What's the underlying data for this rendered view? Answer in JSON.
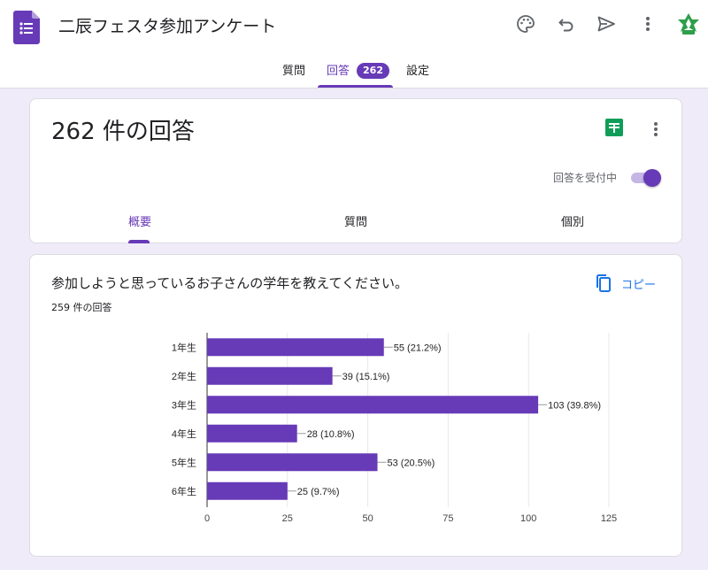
{
  "header": {
    "title": "二辰フェスタ参加アンケート",
    "icons": [
      "forms-logo",
      "palette-icon",
      "undo-icon",
      "send-icon",
      "more-vert-icon",
      "avatar-icon"
    ]
  },
  "tabs": [
    {
      "label": "質問"
    },
    {
      "label": "回答",
      "badge": "262"
    },
    {
      "label": "設定"
    }
  ],
  "summary": {
    "title": "262 件の回答",
    "accepting_label": "回答を受付中",
    "accepting": true,
    "subtabs": [
      {
        "label": "概要"
      },
      {
        "label": "質問"
      },
      {
        "label": "個別"
      }
    ]
  },
  "question": {
    "title": "参加しようと思っているお子さんの学年を教えてください。",
    "response_count": "259 件の回答",
    "copy_label": "コピー"
  },
  "colors": {
    "accent": "#673ab7",
    "bar": "#673ab7",
    "link": "#1a73e8",
    "sheets": "#0f9d58",
    "background": "#f0ebf8"
  },
  "chart_data": {
    "type": "bar",
    "orientation": "horizontal",
    "categories": [
      "1年生",
      "2年生",
      "3年生",
      "4年生",
      "5年生",
      "6年生"
    ],
    "values": [
      55,
      39,
      103,
      28,
      53,
      25
    ],
    "data_labels": [
      "55 (21.2%)",
      "39 (15.1%)",
      "103 (39.8%)",
      "28 (10.8%)",
      "53 (20.5%)",
      "25 (9.7%)"
    ],
    "xlim": [
      0,
      125
    ],
    "xticks": [
      0,
      25,
      50,
      75,
      100,
      125
    ],
    "grid": true,
    "title": "",
    "xlabel": "",
    "ylabel": ""
  }
}
